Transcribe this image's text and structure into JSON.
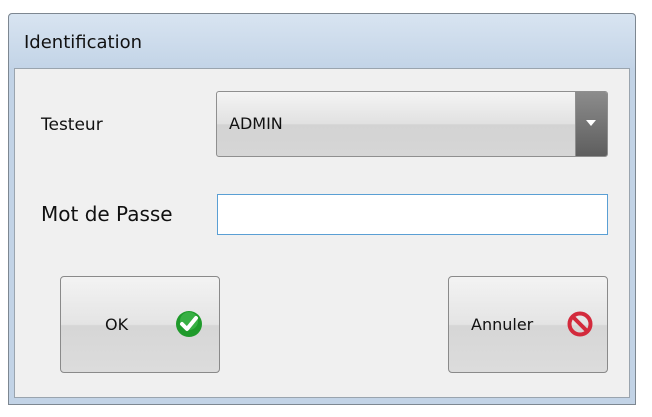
{
  "window": {
    "title": "Identification"
  },
  "form": {
    "tester_label": "Testeur",
    "tester_value": "ADMIN",
    "password_label": "Mot de Passe",
    "password_value": ""
  },
  "buttons": {
    "ok_label": "OK",
    "ok_icon": "check-circle-icon",
    "cancel_label": "Annuler",
    "cancel_icon": "cancel-circle-icon"
  },
  "colors": {
    "ok_icon": "#1f9a2b",
    "cancel_icon": "#d32a3c",
    "focus_border": "#5a9fd4"
  }
}
